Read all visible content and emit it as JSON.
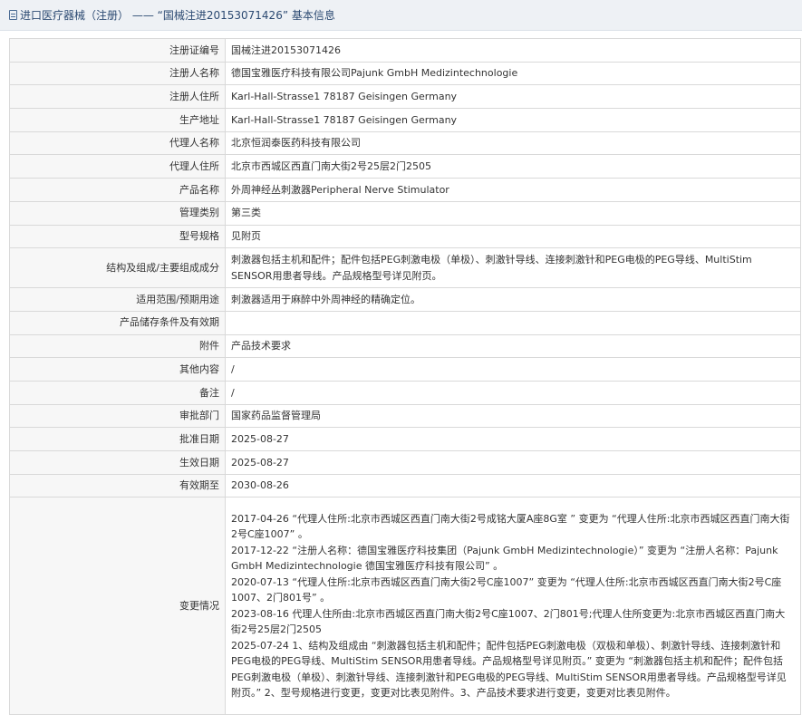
{
  "header": {
    "title": "进口医疗器械（注册） —— “国械注进20153071426” 基本信息"
  },
  "rows": [
    {
      "label": "注册证编号",
      "value": "国械注进20153071426"
    },
    {
      "label": "注册人名称",
      "value": "德国宝雅医疗科技有限公司Pajunk GmbH Medizintechnologie"
    },
    {
      "label": "注册人住所",
      "value": "Karl-Hall-Strasse1 78187 Geisingen Germany"
    },
    {
      "label": "生产地址",
      "value": "Karl-Hall-Strasse1 78187 Geisingen Germany"
    },
    {
      "label": "代理人名称",
      "value": "北京恒润泰医药科技有限公司"
    },
    {
      "label": "代理人住所",
      "value": "北京市西城区西直门南大街2号25层2门2505"
    },
    {
      "label": "产品名称",
      "value": "外周神经丛刺激器Peripheral Nerve Stimulator"
    },
    {
      "label": "管理类别",
      "value": "第三类"
    },
    {
      "label": "型号规格",
      "value": "见附页"
    },
    {
      "label": "结构及组成/主要组成成分",
      "value": "刺激器包括主机和配件；配件包括PEG刺激电极（单极）、刺激针导线、连接刺激针和PEG电极的PEG导线、MultiStim SENSOR用患者导线。产品规格型号详见附页。"
    },
    {
      "label": "适用范围/预期用途",
      "value": "刺激器适用于麻醉中外周神经的精确定位。"
    },
    {
      "label": "产品储存条件及有效期",
      "value": ""
    },
    {
      "label": "附件",
      "value": "产品技术要求"
    },
    {
      "label": "其他内容",
      "value": "/"
    },
    {
      "label": "备注",
      "value": "/"
    },
    {
      "label": "审批部门",
      "value": "国家药品监督管理局"
    },
    {
      "label": "批准日期",
      "value": "2025-08-27"
    },
    {
      "label": "生效日期",
      "value": "2025-08-27"
    },
    {
      "label": "有效期至",
      "value": "2030-08-26"
    }
  ],
  "changes": {
    "label": "变更情况",
    "entries": [
      "2017-04-26 “代理人住所:北京市西城区西直门南大街2号成铭大厦A座8G室 ” 变更为 “代理人住所:北京市西城区西直门南大街2号C座1007” 。",
      "2017-12-22 “注册人名称：德国宝雅医疗科技集团（Pajunk GmbH Medizintechnologie）” 变更为 “注册人名称：Pajunk GmbH Medizintechnologie 德国宝雅医疗科技有限公司” 。",
      "2020-07-13 “代理人住所:北京市西城区西直门南大街2号C座1007” 变更为 “代理人住所:北京市西城区西直门南大街2号C座1007、2门801号” 。",
      "2023-08-16 代理人住所由:北京市西城区西直门南大街2号C座1007、2门801号;代理人住所变更为:北京市西城区西直门南大街2号25层2门2505",
      "2025-07-24 1、结构及组成由 “刺激器包括主机和配件；配件包括PEG刺激电极（双极和单极）、刺激针导线、连接刺激针和PEG电极的PEG导线、MultiStim SENSOR用患者导线。产品规格型号详见附页。” 变更为 “刺激器包括主机和配件；配件包括PEG刺激电极（单极）、刺激针导线、连接刺激针和PEG电极的PEG导线、MultiStim SENSOR用患者导线。产品规格型号详见附页。” 2、型号规格进行变更，变更对比表见附件。3、产品技术要求进行变更，变更对比表见附件。"
    ]
  }
}
